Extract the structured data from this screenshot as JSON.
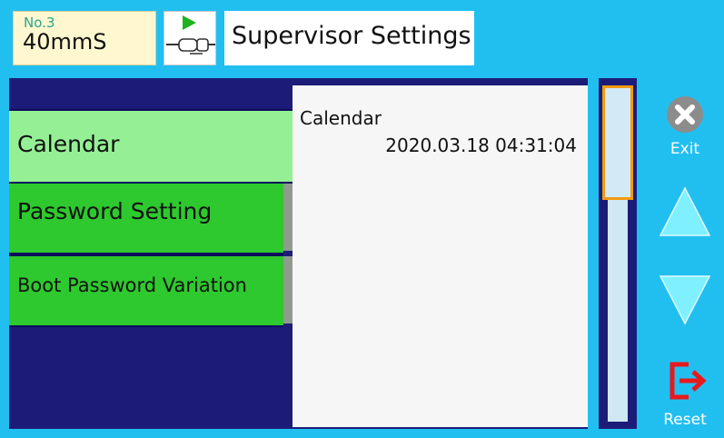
{
  "header": {
    "status_small": "No.3",
    "status_main": "40mmS",
    "mode_icon": "play-cable-icon",
    "title": "Supervisor Settings"
  },
  "menu": {
    "items": [
      {
        "label": "Calendar",
        "selected": true
      },
      {
        "label": "Password Setting",
        "selected": false
      },
      {
        "label": "Boot Password Variation",
        "selected": false
      }
    ]
  },
  "detail": {
    "title": "Calendar",
    "value": "2020.03.18 04:31:04"
  },
  "controls": {
    "exit_label": "Exit",
    "reset_label": "Reset",
    "up_icon": "triangle-up-icon",
    "down_icon": "triangle-down-icon"
  },
  "colors": {
    "background": "#21bff0",
    "panel": "#1c1c78",
    "menu_item": "#2ec92e",
    "menu_item_selected": "#95f095",
    "scroll_thumb_border": "#f29a10",
    "reset_icon": "#e8191e"
  }
}
